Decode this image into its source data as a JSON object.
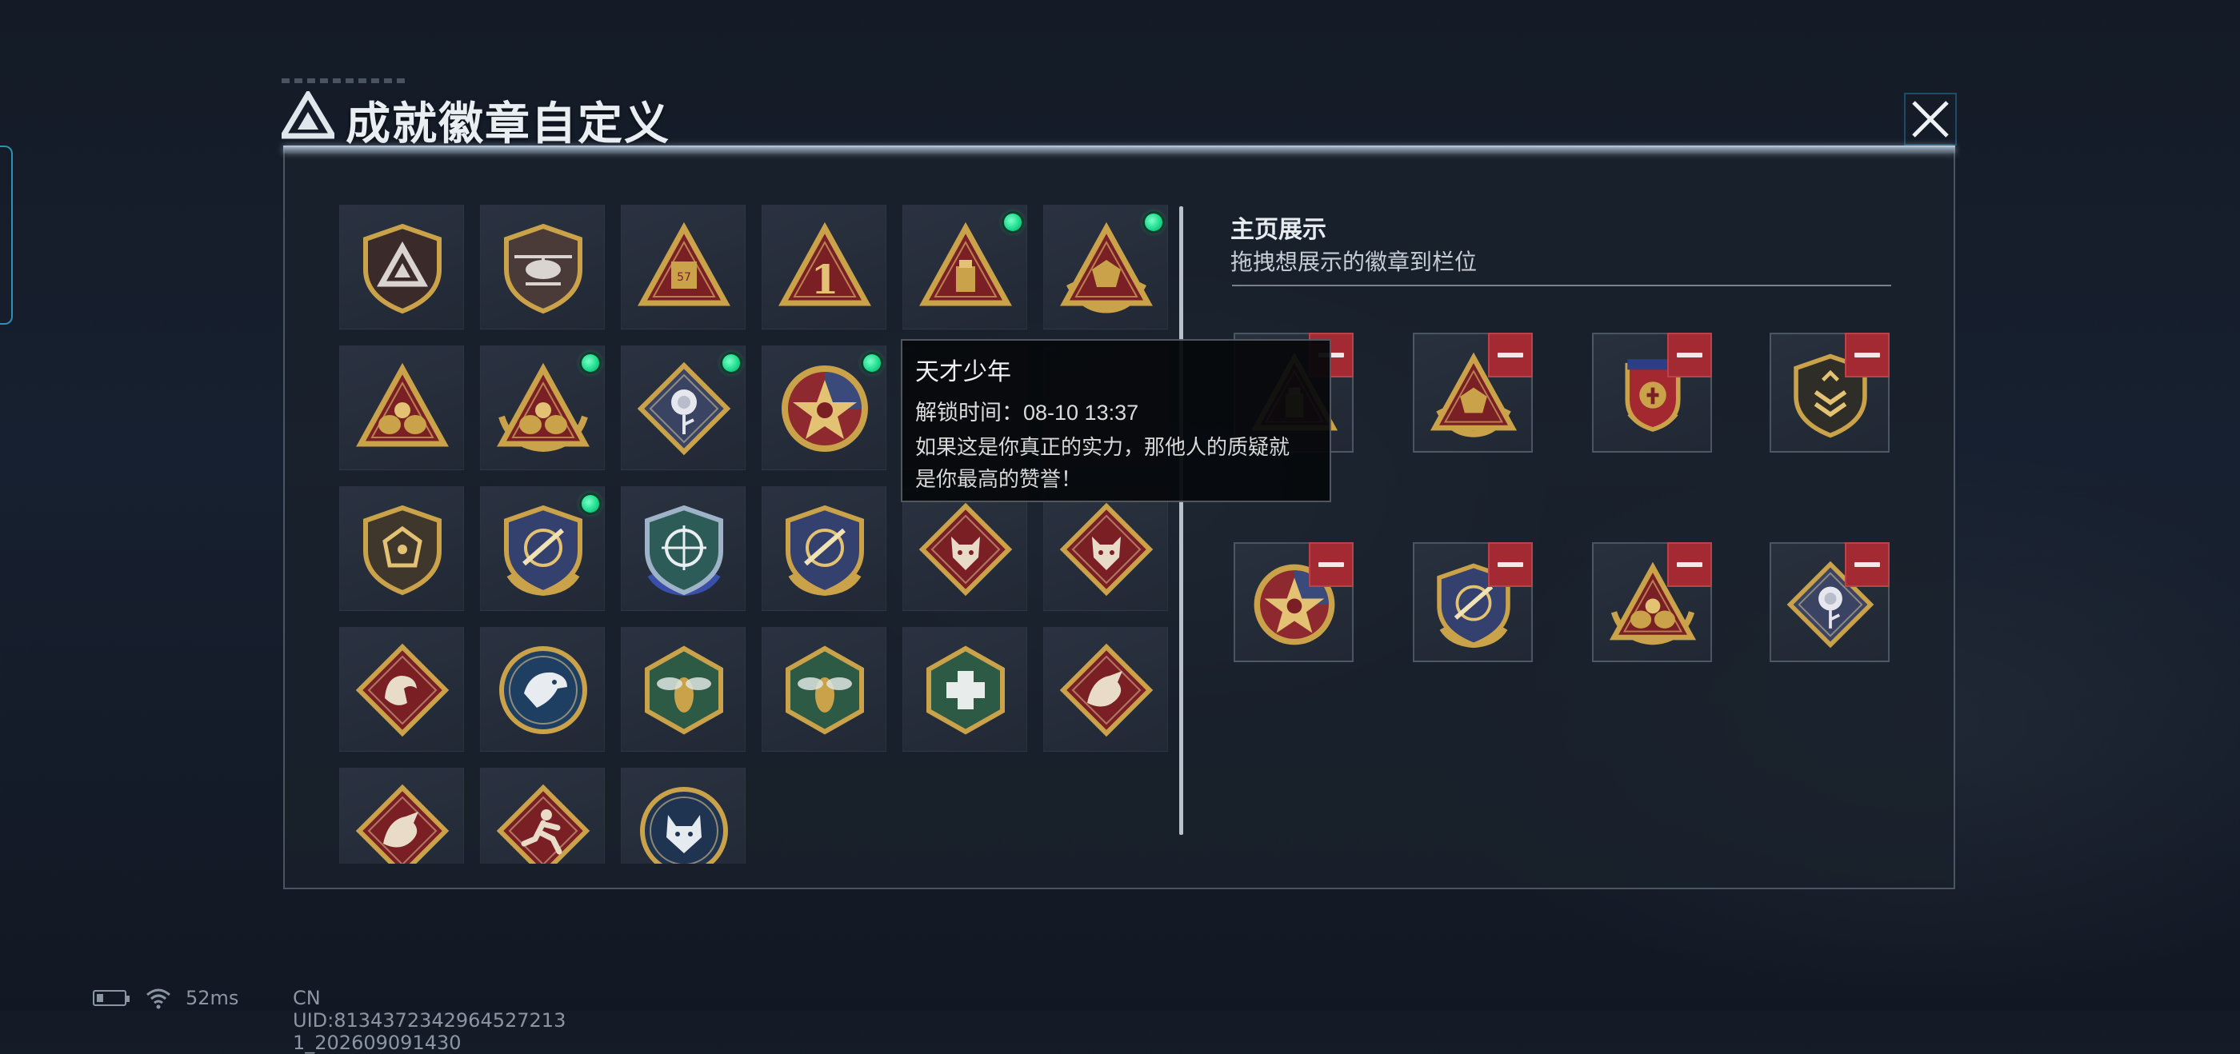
{
  "title": "成就徽章自定义",
  "close_icon": "close-x-icon",
  "grid_badges": [
    {
      "icon": "shield-triangle-emblem-icon",
      "new": false
    },
    {
      "icon": "helicopter-shield-icon",
      "new": false
    },
    {
      "icon": "triangle-57-crate-icon",
      "new": false
    },
    {
      "icon": "triangle-number-1-icon",
      "new": false
    },
    {
      "icon": "triangle-usb-icon",
      "new": true
    },
    {
      "icon": "triangle-dice-wreath-icon",
      "new": true
    },
    {
      "icon": "triangle-bears-icon",
      "new": false
    },
    {
      "icon": "triangle-bears-laurel-icon",
      "new": true
    },
    {
      "icon": "rose-diamond-icon",
      "new": true
    },
    {
      "icon": "star-medal-icon",
      "new": true
    },
    {
      "icon": "hidden-badge",
      "new": false
    },
    {
      "icon": "hidden-badge",
      "new": false
    },
    {
      "icon": "dice-shield-icon",
      "new": false
    },
    {
      "icon": "rifle-shield-laurel-icon",
      "new": true
    },
    {
      "icon": "crosshair-shield-blue-icon",
      "new": false
    },
    {
      "icon": "rifle-shield-gold-icon",
      "new": false
    },
    {
      "icon": "wolf-diamond-icon",
      "new": false
    },
    {
      "icon": "wolf-diamond-icon",
      "new": false
    },
    {
      "icon": "flexing-arm-diamond-icon",
      "new": false
    },
    {
      "icon": "eagle-circle-icon",
      "new": false
    },
    {
      "icon": "hornet-hexagon-icon",
      "new": false
    },
    {
      "icon": "hornet-hexagon-icon",
      "new": false
    },
    {
      "icon": "medkit-hexagon-icon",
      "new": false
    },
    {
      "icon": "dragon-diamond-icon",
      "new": false
    },
    {
      "icon": "dragon-diamond-icon",
      "new": false
    },
    {
      "icon": "runner-diamond-icon",
      "new": false
    },
    {
      "icon": "lynx-circle-icon",
      "new": false
    }
  ],
  "showcase": {
    "title": "主页展示",
    "subtitle": "拖拽想展示的徽章到栏位",
    "slots": [
      {
        "icon": "triangle-usb-icon"
      },
      {
        "icon": "triangle-dice-wreath-icon"
      },
      {
        "icon": "red-crest-medal-icon"
      },
      {
        "icon": "dark-shield-chevron-icon"
      },
      {
        "icon": "star-medal-icon"
      },
      {
        "icon": "rifle-shield-laurel-icon"
      },
      {
        "icon": "triangle-bears-laurel-icon"
      },
      {
        "icon": "rose-diamond-icon"
      }
    ],
    "remove_icon": "minus-icon"
  },
  "tooltip": {
    "title": "天才少年",
    "unlock_time": "解锁时间：08-10 13:37",
    "description_line1": "如果这是你真正的实力，那他人的质疑就",
    "description_line2": "是你最高的赞誉！"
  },
  "status": {
    "ping": "52ms",
    "uid": "CN UID:8134372342964527213 1_202609091430"
  },
  "colors": {
    "new_dot": "#17d98a",
    "remove_button": "#a32a33",
    "gold": "#c9a24a",
    "crimson": "#7a1f24"
  }
}
